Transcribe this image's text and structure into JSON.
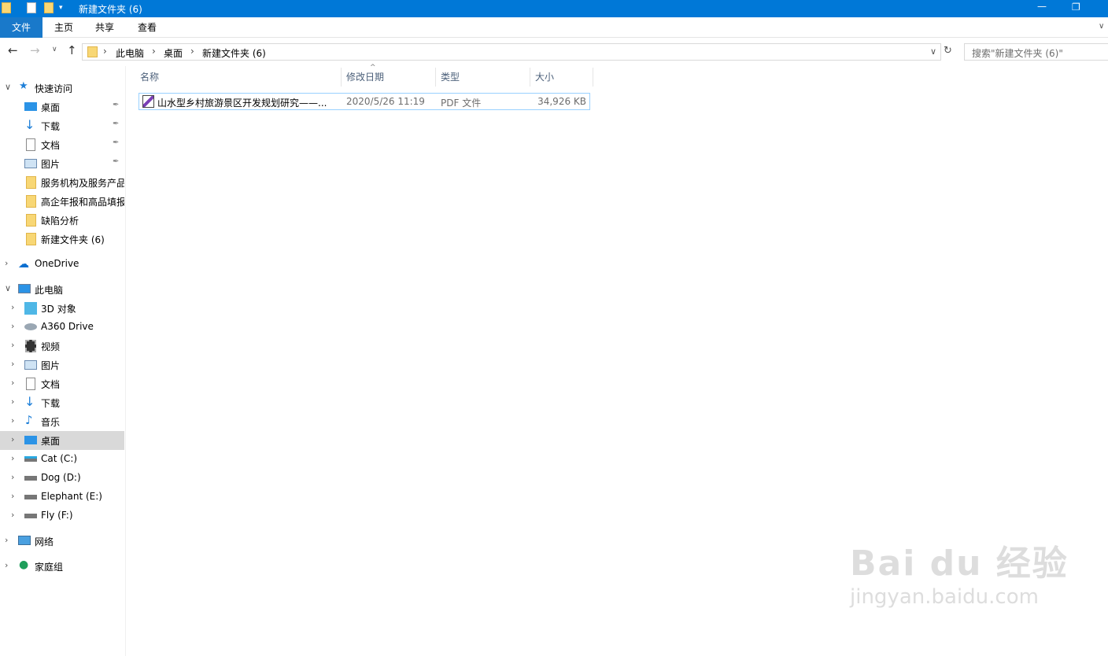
{
  "window": {
    "title": "新建文件夹 (6)"
  },
  "ribbon": {
    "tabs": [
      "文件",
      "主页",
      "共享",
      "查看"
    ]
  },
  "address": {
    "crumbs": [
      "此电脑",
      "桌面",
      "新建文件夹 (6)"
    ],
    "search_placeholder": "搜索\"新建文件夹 (6)\""
  },
  "nav": {
    "quick_access": "快速访问",
    "quick_items": [
      "桌面",
      "下载",
      "文档",
      "图片",
      "服务机构及服务产品",
      "高企年报和高品填报",
      "缺陷分析",
      "新建文件夹 (6)"
    ],
    "onedrive": "OneDrive",
    "this_pc": "此电脑",
    "pc_items": [
      "3D 对象",
      "A360 Drive",
      "视频",
      "图片",
      "文档",
      "下载",
      "音乐",
      "桌面",
      "Cat (C:)",
      "Dog (D:)",
      "Elephant (E:)",
      "Fly (F:)"
    ],
    "network": "网络",
    "homegroup": "家庭组"
  },
  "list": {
    "columns": [
      "名称",
      "修改日期",
      "类型",
      "大小"
    ],
    "rows": [
      {
        "name": "山水型乡村旅游景区开发规划研究——...",
        "date": "2020/5/26 11:19",
        "type": "PDF 文件",
        "size": "34,926 KB"
      }
    ]
  },
  "watermark": {
    "brand": "Bai du 经验",
    "url": "jingyan.baidu.com"
  },
  "colors": {
    "titlebar": "#0078d7",
    "file_tab": "#1979ca",
    "selection_border": "#99d1ff",
    "nav_selected": "#d9d9d9"
  }
}
